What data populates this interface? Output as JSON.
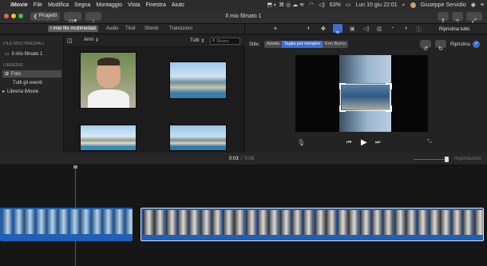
{
  "menubar": {
    "app": "iMovie",
    "items": [
      "File",
      "Modifica",
      "Segna",
      "Montaggio",
      "Vista",
      "Finestra",
      "Aiuto"
    ],
    "battery": "63%",
    "datetime": "Lun 10 giu  22:01",
    "user": "Giuseppe Servidio"
  },
  "toolbar": {
    "projects_label": "Progetti",
    "project_title": "Il mio filmato 1"
  },
  "browser_tabs": [
    "I miei file multimediali",
    "Audio",
    "Titoli",
    "Sfondi",
    "Transizioni"
  ],
  "sidebar": {
    "section1": "FILE MULTIMEDIALI",
    "project": "Il mio filmato 1",
    "section2": "LIBRERIE",
    "items": [
      "Foto",
      "Tutti gli eventi",
      "Libreria iMovie"
    ]
  },
  "browser": {
    "year_select": "Anni",
    "filter_select": "Tutti",
    "search_placeholder": "Ricerc"
  },
  "viewer": {
    "style_label": "Stile:",
    "styles": [
      "Adatta",
      "Taglia per riempire",
      "Ken Burns"
    ],
    "reset_all": "Ripristina tutto",
    "reset": "Ripristina",
    "time_current": "0:03",
    "time_separator": "/",
    "time_total": "0:08"
  },
  "timeline": {
    "settings_label": "Impostazioni"
  }
}
